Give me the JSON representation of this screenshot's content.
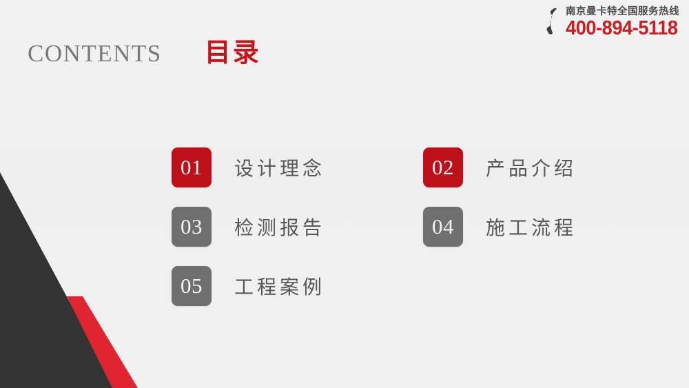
{
  "slide": {
    "background_color": "#F1F1F1"
  },
  "hotline": {
    "icon": "phone-handset-icon",
    "label": "南京曼卡特全国服务热线",
    "number": "400-894-5118",
    "number_color": "#CD1E22",
    "label_color": "#4B4B4B"
  },
  "title": {
    "english": "CONTENTS",
    "chinese": "目录",
    "english_color": "#7A7A7A",
    "chinese_color": "#C4151C"
  },
  "contents": {
    "items": [
      {
        "number": "01",
        "label": "设计理念",
        "color": "#BE1018",
        "style": "red"
      },
      {
        "number": "02",
        "label": "产品介绍",
        "color": "#BE1018",
        "style": "red"
      },
      {
        "number": "03",
        "label": "检测报告",
        "color": "#6F6F6F",
        "style": "gray"
      },
      {
        "number": "04",
        "label": "施工流程",
        "color": "#6F6F6F",
        "style": "gray"
      },
      {
        "number": "05",
        "label": "工程案例",
        "color": "#6F6F6F",
        "style": "gray"
      }
    ]
  },
  "decoration": {
    "triangle_color": "#333333",
    "stripe_color": "#E02430"
  }
}
